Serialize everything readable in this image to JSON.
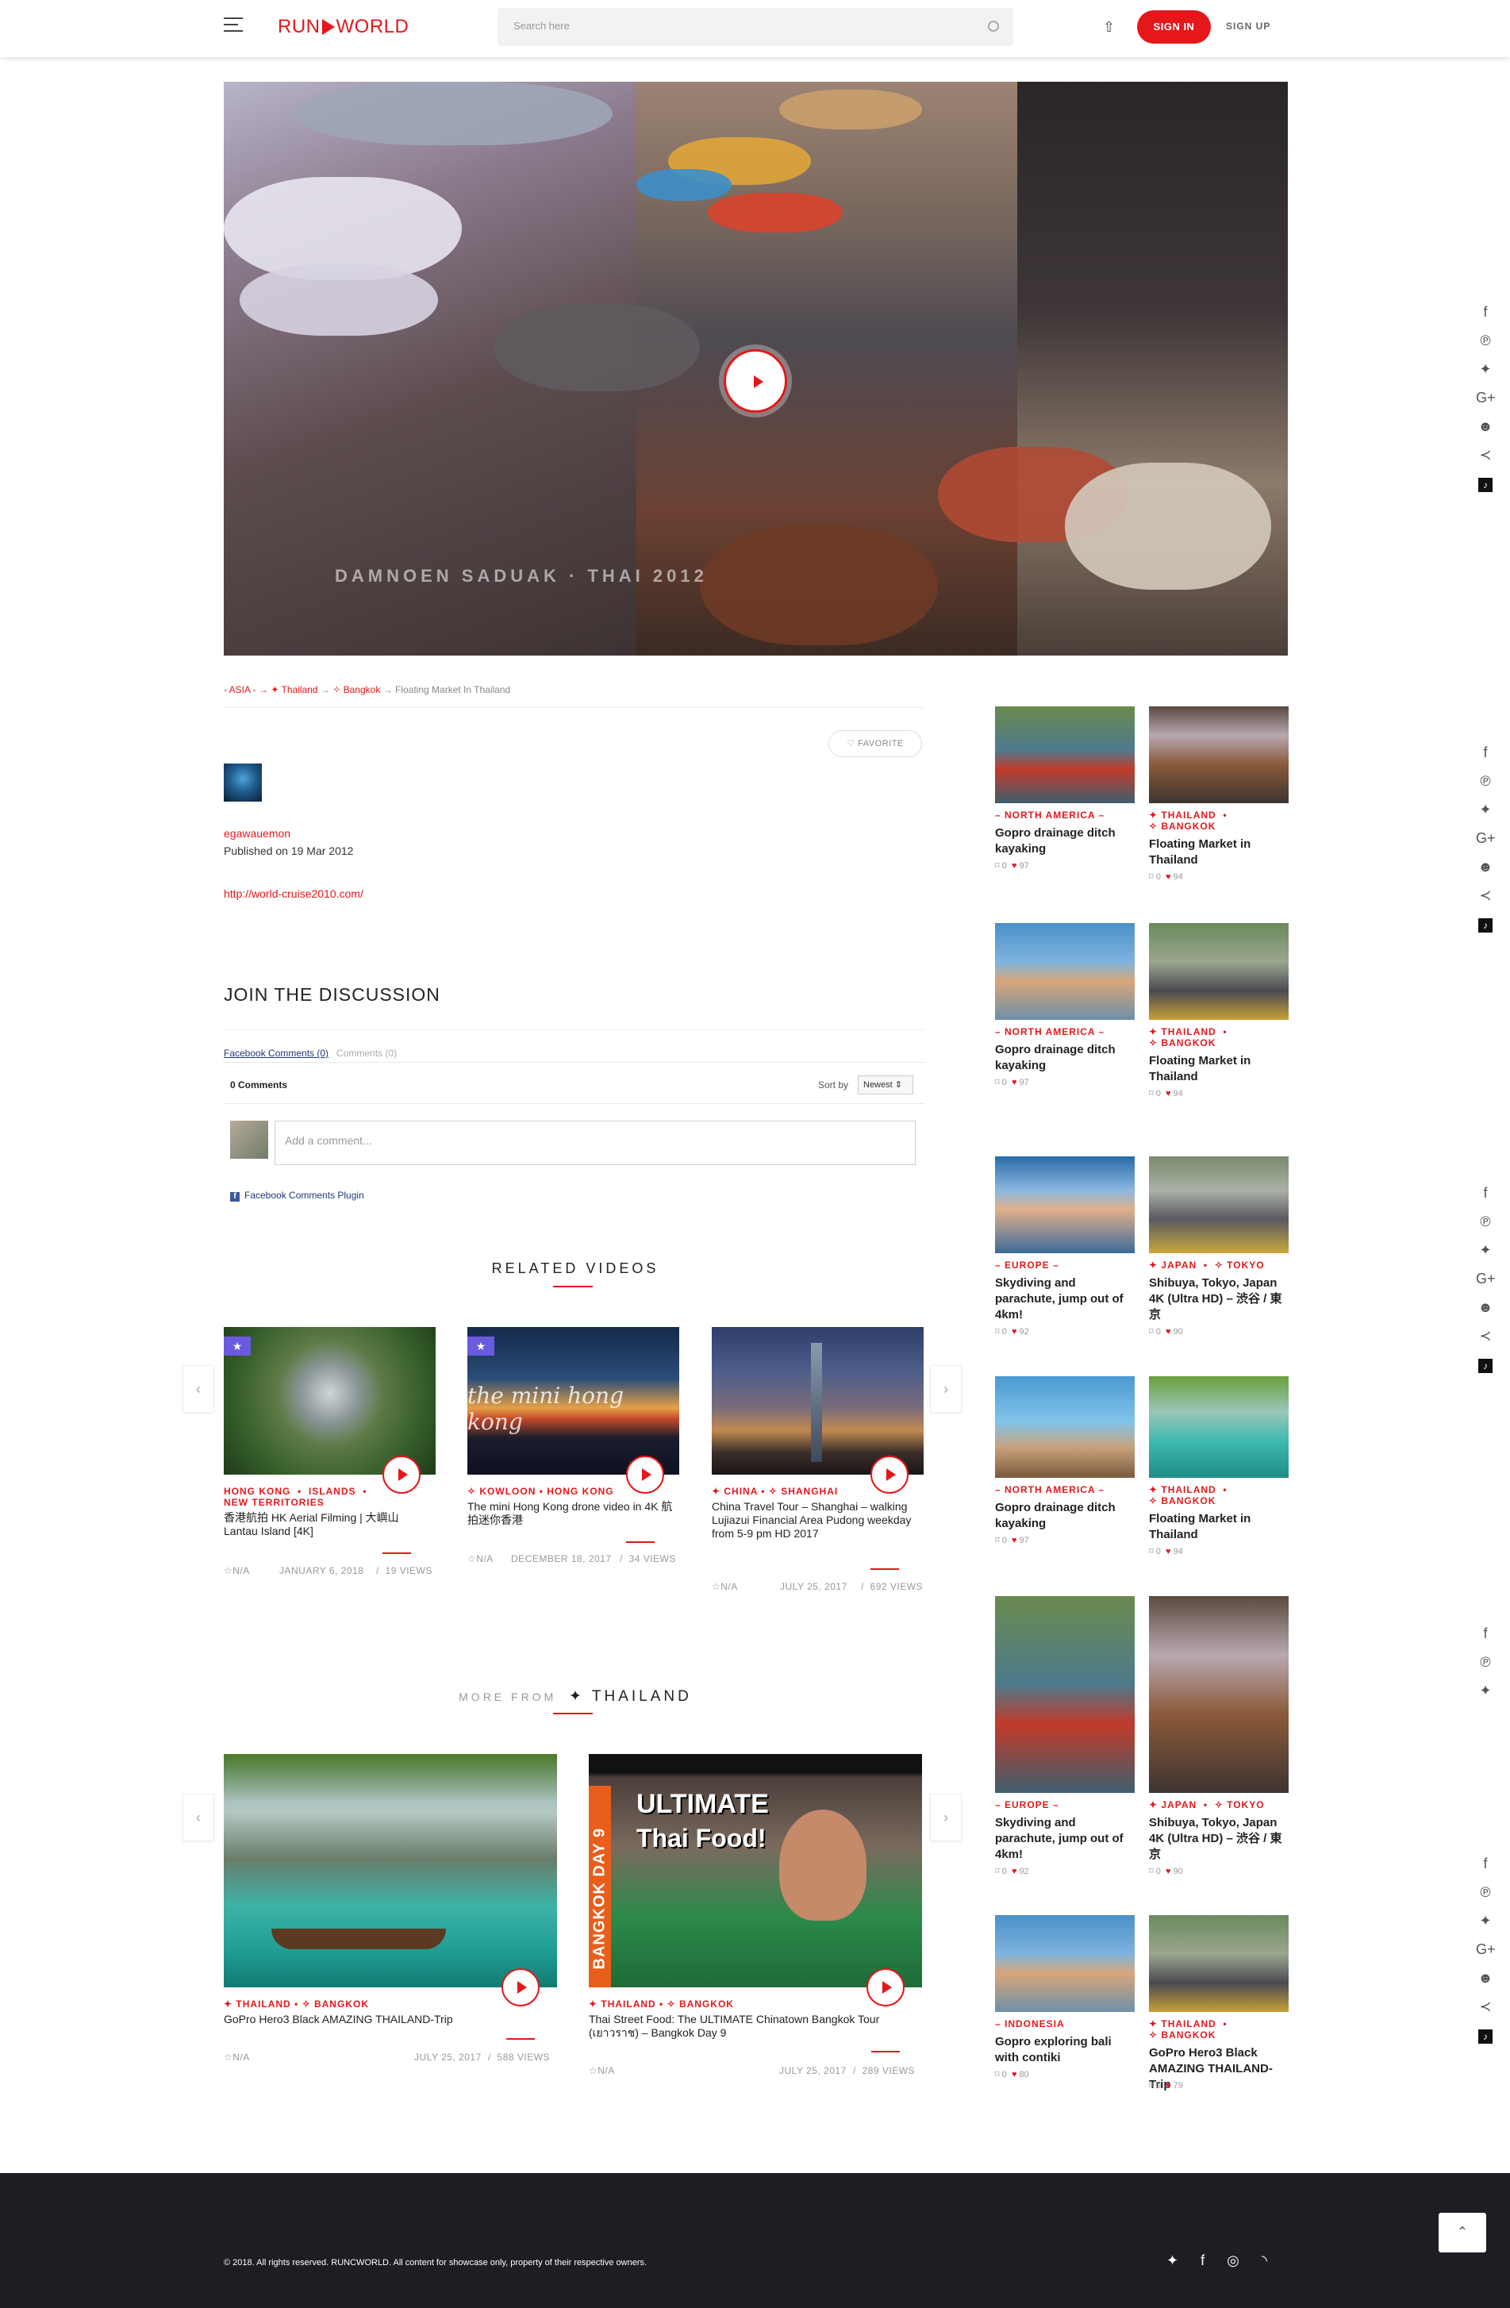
{
  "header": {
    "logo_left": "RUN",
    "logo_right": "WORLD",
    "search_placeholder": "Search here",
    "signin": "SIGN IN",
    "signup": "SIGN UP"
  },
  "video": {
    "overlay_title": "DAMNOEN SADUAK · THAI 2012"
  },
  "breadcrumb": {
    "asia": "- ASIA - ",
    "arr1": "→ ",
    "thailand": "✦ Thailand",
    "arr2": " → ",
    "bangkok": "✧ Bangkok",
    "current": " → Floating Market In Thailand"
  },
  "favorite": "♡ FAVORITE",
  "author": {
    "name": "egawauemon",
    "published": "Published on 19 Mar 2012",
    "link": "http://world-cruise2010.com/"
  },
  "discussion": {
    "title": "JOIN THE DISCUSSION",
    "tab_facebook": "Facebook Comments (0)",
    "tab_comments": "Comments (0)",
    "count": "0 Comments",
    "sort_label": "Sort by",
    "sort_value": "Newest ⇕",
    "placeholder": "Add a comment...",
    "plugin": "Facebook Comments Plugin"
  },
  "related": {
    "title": "RELATED VIDEOS",
    "items": [
      {
        "tags": "HONG KONG  •  ISLANDS  •\nNEW TERRITORIES",
        "title": "香港航拍 HK Aerial Filming | 大嶼山 Lantau Island [4K]",
        "rating": "☆N/A",
        "date": "JANUARY 6, 2018",
        "views": "19 VIEWS"
      },
      {
        "tags": "✧ KOWLOON  •  HONG KONG",
        "title": "The mini Hong Kong drone video in 4K 航拍迷你香港",
        "rating": "☆N/A",
        "date": "DECEMBER 18, 2017",
        "views": "34 VIEWS",
        "overlay": "the mini hong kong"
      },
      {
        "tags": "✦ CHINA  •  ✧ SHANGHAI",
        "title": "China Travel Tour – Shanghai – walking Lujiazui Financial Area Pudong weekday from 5-9 pm HD 2017",
        "rating": "☆N/A",
        "date": "JULY 25, 2017",
        "views": "692 VIEWS"
      }
    ]
  },
  "more": {
    "prefix": "MORE FROM",
    "name": "✦ THAILAND",
    "items": [
      {
        "tags": "✦ THAILAND  •  ✧ BANGKOK",
        "title": "GoPro Hero3 Black AMAZING THAILAND-Trip",
        "rating": "☆N/A",
        "date": "JULY 25, 2017",
        "views": "588 VIEWS"
      },
      {
        "tags": "✦ THAILAND  •  ✧ BANGKOK",
        "title": "Thai Street Food: The ULTIMATE Chinatown Bangkok Tour (เยาวราช) – Bangkok Day 9",
        "rating": "☆N/A",
        "date": "JULY 25, 2017",
        "views": "289 VIEWS",
        "thumb_big": "ULTIMATE",
        "thumb_big2": "Thai Food!",
        "thumb_side": "BANGKOK DAY 9"
      }
    ]
  },
  "sidebar": [
    {
      "tags": "– NORTH AMERICA –",
      "title": "Gopro drainage ditch kayaking",
      "c": "0",
      "l": "97"
    },
    {
      "tags": "✦ THAILAND  •\n✧ BANGKOK",
      "title": "Floating Market in Thailand",
      "c": "0",
      "l": "94"
    },
    {
      "tags": "– NORTH AMERICA –",
      "title": "Gopro drainage ditch kayaking",
      "c": "0",
      "l": "97"
    },
    {
      "tags": "✦ THAILAND  •\n✧ BANGKOK",
      "title": "Floating Market in Thailand",
      "c": "0",
      "l": "94"
    },
    {
      "tags": "– EUROPE –",
      "title": "Skydiving and parachute, jump out of 4km!",
      "c": "0",
      "l": "92"
    },
    {
      "tags": "✦ JAPAN  •  ✧ TOKYO",
      "title": "Shibuya, Tokyo, Japan 4K (Ultra HD) – 渋谷 / 東京",
      "c": "0",
      "l": "90"
    },
    {
      "tags": "– NORTH AMERICA –",
      "title": "Gopro drainage ditch kayaking",
      "c": "0",
      "l": "97"
    },
    {
      "tags": "✦ THAILAND  •\n✧ BANGKOK",
      "title": "Floating Market in Thailand",
      "c": "0",
      "l": "94"
    },
    {
      "tags": "– EUROPE –",
      "title": "Skydiving and parachute, jump out of 4km!",
      "c": "0",
      "l": "92"
    },
    {
      "tags": "✦ JAPAN  •  ✧ TOKYO",
      "title": "Shibuya, Tokyo, Japan 4K (Ultra HD) – 渋谷 / 東京",
      "c": "0",
      "l": "90"
    },
    {
      "tags": "– INDONESIA",
      "title": "Gopro exploring bali with contiki",
      "c": "0",
      "l": "80"
    },
    {
      "tags": "✦ THAILAND  •\n✧ BANGKOK",
      "title": "GoPro Hero3 Black AMAZING THAILAND-Trip",
      "c": "0",
      "l": "79"
    }
  ],
  "footer": {
    "copyright": "© 2018. All rights reserved. RUNCWORLD. All content for showcase only, property of their respective owners."
  }
}
